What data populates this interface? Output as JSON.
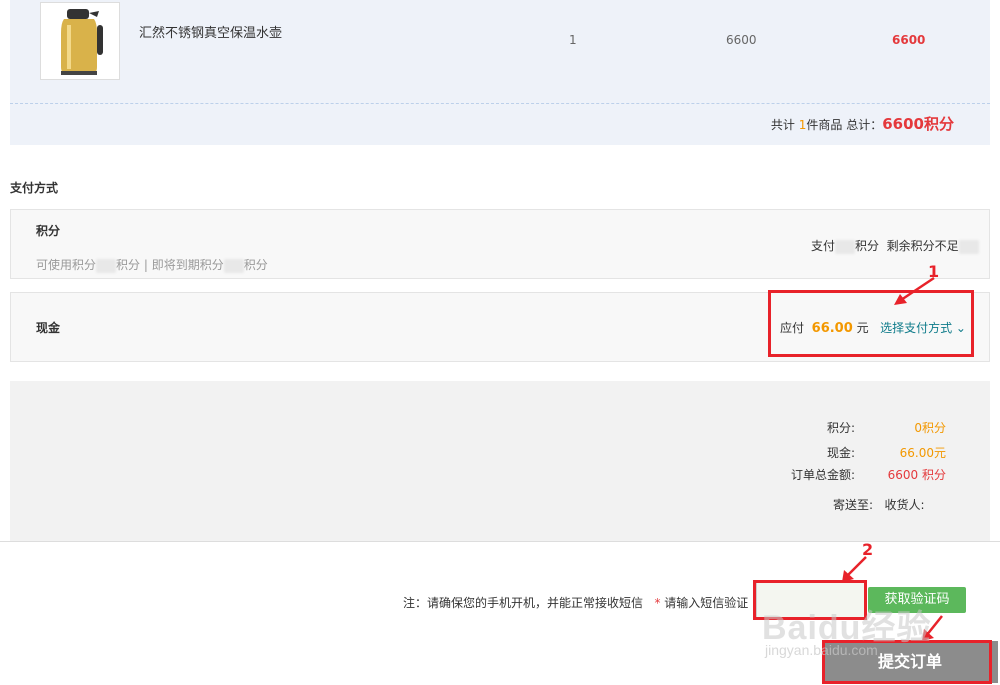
{
  "product": {
    "name": "汇然不锈钢真空保温水壶",
    "quantity": "1",
    "price": "6600",
    "subtotal": "6600"
  },
  "summary": {
    "prefix": "共计",
    "count": "1",
    "count_suffix": "件商品",
    "total_label": "总计：",
    "total_value": "6600积分"
  },
  "payment": {
    "section_title": "支付方式",
    "points": {
      "title": "积分",
      "available_label": "可使用积分",
      "available_suffix": "积分",
      "separator": " | ",
      "expiring_label": "即将到期积分",
      "expiring_suffix": "积分",
      "pay_label": "支付",
      "pay_suffix": "积分",
      "insufficient_label": "剩余积分不足"
    },
    "cash": {
      "title": "现金",
      "due_label": "应付",
      "due_amount": "66.00",
      "currency": "元",
      "choose_method": "选择支付方式"
    }
  },
  "totals": {
    "points_label": "积分:",
    "points_value": "0积分",
    "cash_label": "现金:",
    "cash_value": "66.00元",
    "order_total_label": "订单总金额:",
    "order_total_value": "6600 积分",
    "ship_to_label": "寄送至:",
    "receiver_label": "收货人:"
  },
  "sms": {
    "note": "注：请确保您的手机开机，并能正常接收短信",
    "required_mark": "*",
    "prompt": "请输入短信验证",
    "get_code_label": "获取验证码"
  },
  "submit_label": "提交订单",
  "annotations": {
    "marker_1": "1",
    "marker_2": "2"
  },
  "watermark": {
    "brand": "Baidu经验",
    "url": "jingyan.baidu.com"
  },
  "colors": {
    "accent_red": "#e4393c",
    "accent_orange": "#f39800",
    "link_teal": "#0e7b8a",
    "annotation_red": "#e8222a",
    "button_green": "#5cb85c"
  }
}
